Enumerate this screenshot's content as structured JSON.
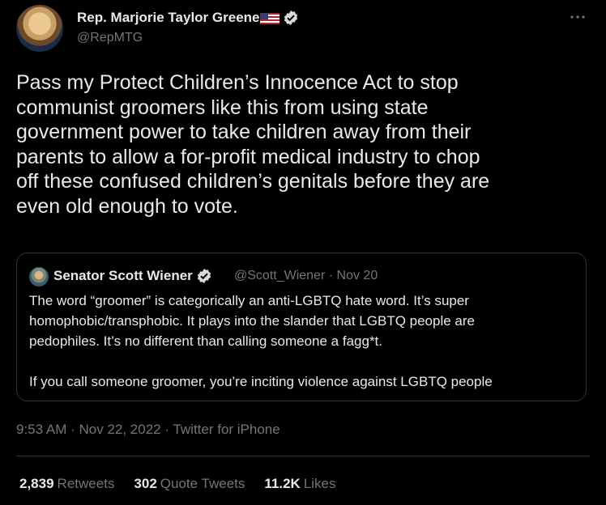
{
  "author": {
    "name": "Rep. Marjorie Taylor Greene",
    "handle": "@RepMTG"
  },
  "icons": {
    "flag": "us-flag-icon",
    "verified": "verified-badge-icon",
    "more": "more-options-icon"
  },
  "tweet": {
    "text": "Pass my Protect Children’s Innocence Act to stop\ncommunist groomers like this from using state\ngovernment power to take children away from their\nparents to allow a for-profit medical industry to chop\noff these confused children’s genitals before they are\neven old enough to vote."
  },
  "quote": {
    "name": "Senator Scott Wiener",
    "handle": "@Scott_Wiener",
    "separator": "·",
    "date": "Nov 20",
    "text": "The word “groomer” is categorically an anti-LGBTQ hate word. It’s super\nhomophobic/transphobic. It plays into the slander that LGBTQ people are\npedophiles. It’s no different than calling someone a fagg*t.\n\nIf you call someone groomer, you’re inciting violence against LGBTQ people"
  },
  "meta": {
    "time": "9:53 AM",
    "date": "Nov 22, 2022",
    "source": "Twitter for iPhone",
    "separator": " · "
  },
  "stats": {
    "retweets_count": "2,839",
    "retweets_label": "Retweets",
    "quotes_count": "302",
    "quotes_label": "Quote Tweets",
    "likes_count": "11.2K",
    "likes_label": "Likes"
  },
  "colors": {
    "background": "#000000",
    "text": "#e7e9ea",
    "secondary": "#71767b",
    "border": "#2f3336",
    "verified": "#d9d9d9"
  }
}
